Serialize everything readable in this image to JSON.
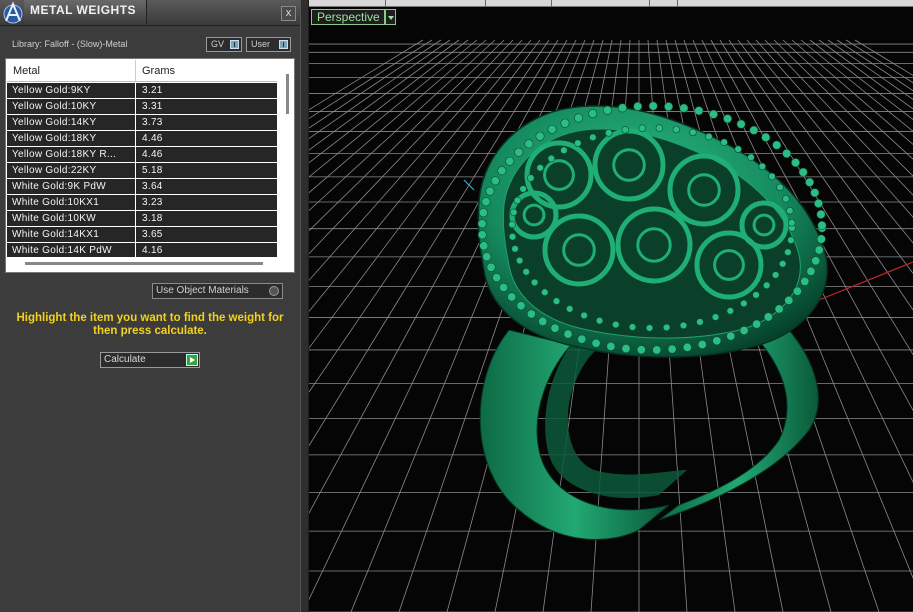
{
  "panel": {
    "title": "METAL WEIGHTS",
    "close_label": "x",
    "library_label": "Library: Falloff - (Slow)-Metal",
    "library_buttons": [
      {
        "label": "GV"
      },
      {
        "label": "User"
      }
    ],
    "table": {
      "columns": [
        "Metal",
        "Grams"
      ],
      "rows": [
        {
          "metal": "Yellow Gold:9KY",
          "grams": "3.21"
        },
        {
          "metal": "Yellow Gold:10KY",
          "grams": "3.31"
        },
        {
          "metal": "Yellow Gold:14KY",
          "grams": "3.73"
        },
        {
          "metal": "Yellow Gold:18KY",
          "grams": "4.46"
        },
        {
          "metal": "Yellow Gold:18KY R...",
          "grams": "4.46"
        },
        {
          "metal": "Yellow Gold:22KY",
          "grams": "5.18"
        },
        {
          "metal": "White Gold:9K PdW",
          "grams": "3.64"
        },
        {
          "metal": "White Gold:10KX1",
          "grams": "3.23"
        },
        {
          "metal": "White Gold:10KW",
          "grams": "3.18"
        },
        {
          "metal": "White Gold:14KX1",
          "grams": "3.65"
        },
        {
          "metal": "White Gold:14K PdW",
          "grams": "4.16"
        }
      ]
    },
    "use_object_materials_label": "Use Object Materials",
    "hint_text": "Highlight the item you want to find the weight for then press calculate.",
    "calculate_label": "Calculate"
  },
  "viewport": {
    "view_name": "Perspective",
    "model_description": "green ring render",
    "colors": {
      "background": "#050505",
      "grid": "#8a8a8a",
      "model": "#178a5e",
      "accent_green": "#9ee29e",
      "hint_yellow": "#f4d21c",
      "axis_red": "#c0282a"
    }
  }
}
